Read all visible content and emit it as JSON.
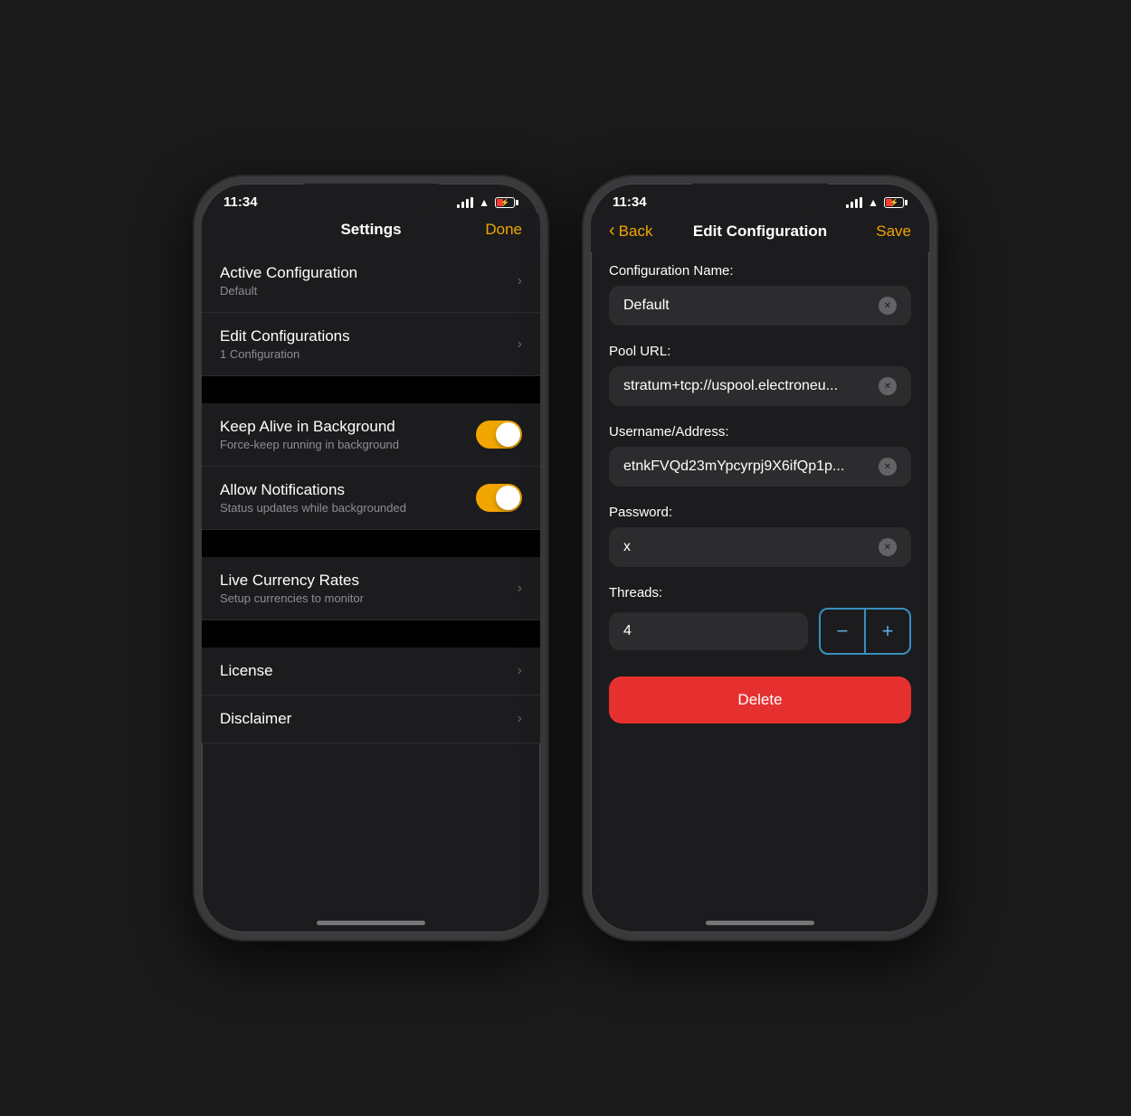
{
  "phone1": {
    "status_bar": {
      "time": "11:34",
      "signal": true,
      "wifi": true,
      "battery": true
    },
    "nav": {
      "title": "Settings",
      "right_action": "Done"
    },
    "settings_items": [
      {
        "id": "active-configuration",
        "title": "Active Configuration",
        "subtitle": "Default",
        "type": "chevron"
      },
      {
        "id": "edit-configurations",
        "title": "Edit Configurations",
        "subtitle": "1 Configuration",
        "type": "chevron"
      },
      {
        "id": "keep-alive",
        "title": "Keep Alive in Background",
        "subtitle": "Force-keep running in background",
        "type": "toggle",
        "value": true
      },
      {
        "id": "allow-notifications",
        "title": "Allow Notifications",
        "subtitle": "Status updates while backgrounded",
        "type": "toggle",
        "value": true
      },
      {
        "id": "live-currency",
        "title": "Live Currency Rates",
        "subtitle": "Setup currencies to monitor",
        "type": "chevron"
      },
      {
        "id": "license",
        "title": "License",
        "subtitle": "",
        "type": "chevron"
      },
      {
        "id": "disclaimer",
        "title": "Disclaimer",
        "subtitle": "",
        "type": "chevron"
      }
    ]
  },
  "phone2": {
    "status_bar": {
      "time": "11:34",
      "signal": true,
      "wifi": true,
      "battery": true
    },
    "nav": {
      "title": "Edit Configuration",
      "back_label": "Back",
      "right_action": "Save"
    },
    "form": {
      "config_name_label": "Configuration Name:",
      "config_name_value": "Default",
      "pool_url_label": "Pool URL:",
      "pool_url_value": "stratum+tcp://uspool.electroneu...",
      "username_label": "Username/Address:",
      "username_value": "etnkFVQd23mYpcyrpj9X6ifQp1p...",
      "password_label": "Password:",
      "password_value": "x",
      "threads_label": "Threads:",
      "threads_value": "4",
      "decrement_label": "−",
      "increment_label": "+",
      "delete_label": "Delete"
    }
  }
}
